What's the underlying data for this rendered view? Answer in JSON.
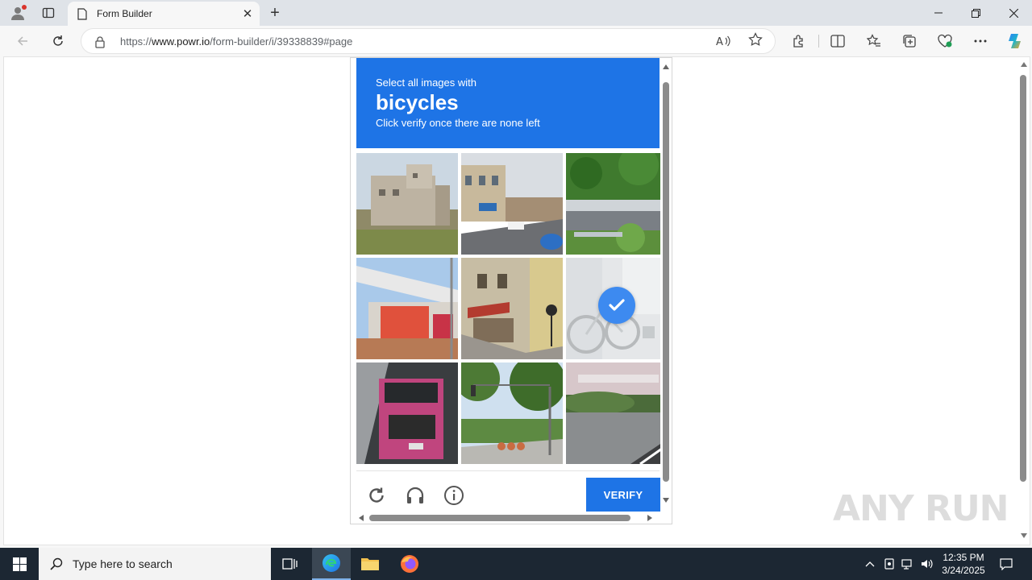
{
  "browser": {
    "tab_title": "Form Builder",
    "url_prefix": "https://",
    "url_host": "www.powr.io",
    "url_path": "/form-builder/i/39338839#page",
    "new_tab_symbol": "+",
    "close_tab_symbol": "✕"
  },
  "captcha": {
    "instruction_prefix": "Select all images with",
    "target": "bicycles",
    "instruction_suffix": "Click verify once there are none left",
    "verify_label": "VERIFY",
    "accent_color": "#1e74e6",
    "tiles": [
      {
        "name": "building",
        "selected": false
      },
      {
        "name": "street",
        "selected": false
      },
      {
        "name": "bridge",
        "selected": false
      },
      {
        "name": "billboard",
        "selected": false
      },
      {
        "name": "cafe",
        "selected": false
      },
      {
        "name": "bicycle",
        "selected": true
      },
      {
        "name": "truck",
        "selected": false
      },
      {
        "name": "traffic-light",
        "selected": false
      },
      {
        "name": "hedge",
        "selected": false
      }
    ],
    "footer_icons": [
      "reload-icon",
      "audio-icon",
      "info-icon"
    ]
  },
  "watermark": "ANY RUN",
  "taskbar": {
    "search_placeholder": "Type here to search",
    "time": "12:35 PM",
    "date": "3/24/2025",
    "apps": [
      "task-view-icon",
      "edge-icon",
      "file-explorer-icon",
      "firefox-icon"
    ]
  }
}
